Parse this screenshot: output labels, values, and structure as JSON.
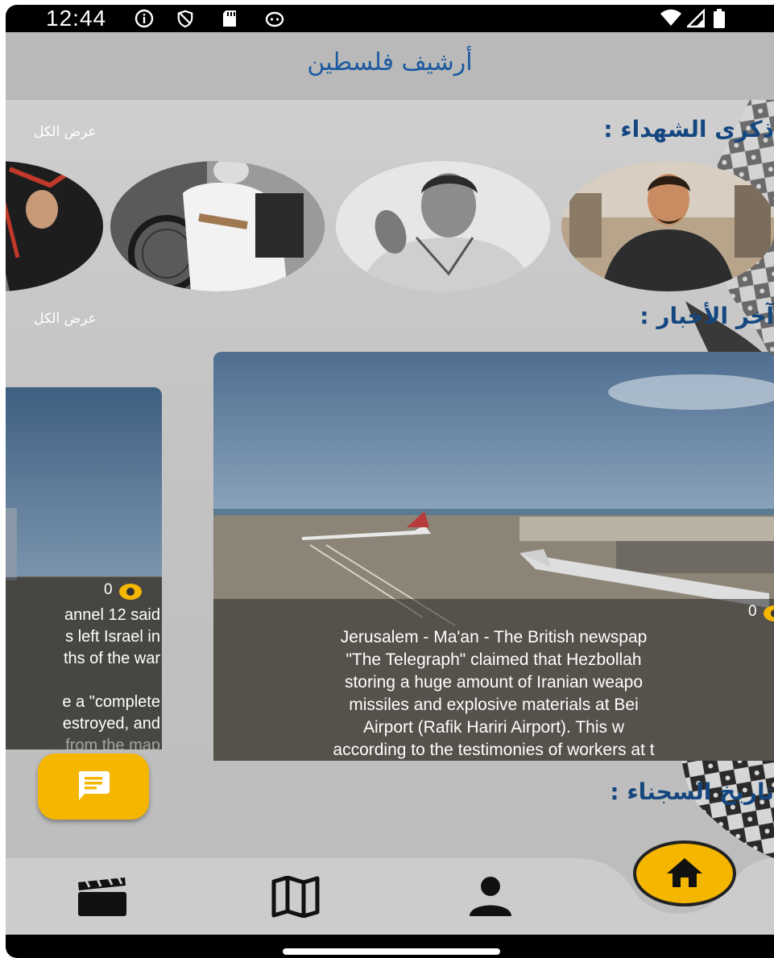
{
  "status_bar": {
    "time": "12:44",
    "icons": [
      "info-icon",
      "shield-icon",
      "sd-card-icon",
      "cat-icon",
      "wifi-icon",
      "signal-icon",
      "battery-icon"
    ]
  },
  "app_bar": {
    "title": "أرشيف فلسطين"
  },
  "sections": {
    "martyrs": {
      "title": "ذكرى الشهداء :",
      "see_all": "عرض الكل"
    },
    "news": {
      "title": "آخر الأخبار :",
      "see_all": "عرض الكل"
    },
    "prisoners": {
      "title": "تاريخ السجناء :"
    }
  },
  "news_cards": [
    {
      "views": "0",
      "lines": [
        "Jerusalem - Ma'an - The British newspap",
        "\"The Telegraph\" claimed that Hezbollah",
        "storing a huge amount of Iranian weapo",
        "missiles and explosive materials at Bei",
        "Airport (Rafik Hariri Airport). This w",
        "according to the testimonies of workers at t"
      ]
    },
    {
      "views": "0",
      "lines": [
        "annel 12 said",
        "s left Israel in",
        "ths of the war",
        "",
        "e a \"complete",
        "estroyed, and",
        "from the map"
      ]
    }
  ],
  "fab": {
    "icon": "chat-icon"
  },
  "bottom_nav": {
    "items": [
      "clapperboard-icon",
      "map-icon",
      "person-icon",
      "home-icon"
    ],
    "active": "home-icon"
  },
  "colors": {
    "accent": "#f5b600",
    "title_blue": "#1c5aa0",
    "section_blue": "#14477f"
  }
}
